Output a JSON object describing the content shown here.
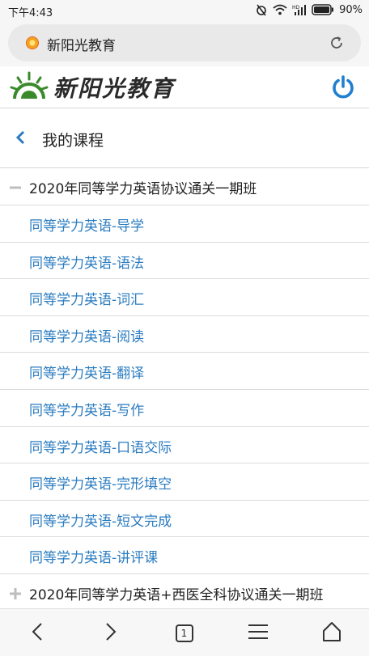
{
  "status_bar": {
    "time": "下午4:43",
    "battery": "90%",
    "network_label": "HD"
  },
  "browser": {
    "url_title": "新阳光教育"
  },
  "header": {
    "logo_text": "新阳光教育"
  },
  "page": {
    "title": "我的课程"
  },
  "course_groups": [
    {
      "title": "2020年同等学力英语协议通关一期班",
      "expanded": true,
      "lessons": [
        "同等学力英语-导学",
        "同等学力英语-语法",
        "同等学力英语-词汇",
        "同等学力英语-阅读",
        "同等学力英语-翻译",
        "同等学力英语-写作",
        "同等学力英语-口语交际",
        "同等学力英语-完形填空",
        "同等学力英语-短文完成",
        "同等学力英语-讲评课"
      ]
    },
    {
      "title": "2020年同等学力英语+西医全科协议通关一期班",
      "expanded": false,
      "lessons": []
    }
  ],
  "bottom_nav": {
    "tab_count": "1"
  },
  "colors": {
    "accent": "#2b7cc0",
    "power": "#1f7fd0",
    "logo_green": "#3a8a2c"
  }
}
